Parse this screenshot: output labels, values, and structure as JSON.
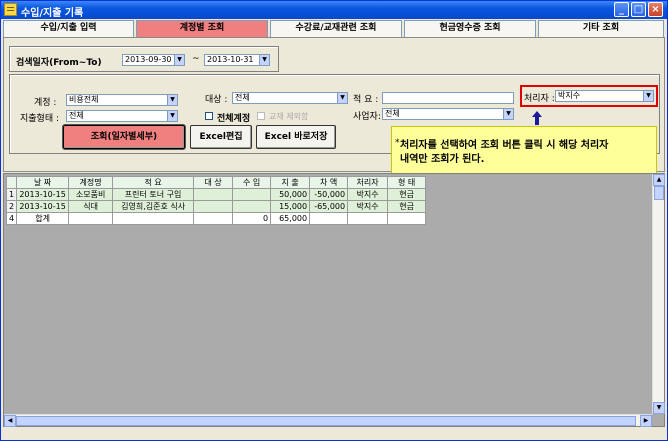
{
  "window": {
    "title": "수입/지출 기록"
  },
  "tabs": [
    {
      "label": "수입/지출 입력"
    },
    {
      "label": "계정별 조회"
    },
    {
      "label": "수강료/교재관련 조회"
    },
    {
      "label": "현금영수증 조회"
    },
    {
      "label": "기타 조회"
    }
  ],
  "date_search": {
    "label": "검색일자(From~To)",
    "from": "2013-09-30",
    "tilde": "~",
    "to": "2013-10-31"
  },
  "filters": {
    "account_label": "계정 :",
    "account_value": "비용전체",
    "expense_type_label": "지출형태 :",
    "expense_type_value": "전체",
    "target_label": "대상 :",
    "target_value": "전체",
    "all_accounts_label": "전체계정",
    "textbook_label": "교재 제외함",
    "summary_label": "적 요 :",
    "summary_value": "",
    "business_label": "사업자:",
    "business_value": "전체",
    "handler_label": "처리자 :",
    "handler_value": "박지수"
  },
  "buttons": {
    "search": "조회(일자별세부)",
    "excel_edit": "Excel편집",
    "excel_save": "Excel 바로저장"
  },
  "callout": {
    "star": "*",
    "line1": "처리자를 선택하여 조회 버튼 클릭 시 해당 처리자",
    "line2": "내역만 조회가 된다."
  },
  "table": {
    "headers": [
      "날 짜",
      "계정명",
      "적 요",
      "대 상",
      "수 입",
      "지 출",
      "차 액",
      "처리자",
      "형 태"
    ],
    "rows": [
      {
        "rn": "1",
        "date": "2013-10-15",
        "account": "소모품비",
        "summary": "프린터 토너 구입",
        "target": "",
        "income": "",
        "expense": "50,000",
        "balance": "-50,000",
        "handler": "박지수",
        "type": "현금"
      },
      {
        "rn": "2",
        "date": "2013-10-15",
        "account": "식대",
        "summary": "김영희,김준호 식사",
        "target": "",
        "income": "",
        "expense": "15,000",
        "balance": "-65,000",
        "handler": "박지수",
        "type": "현금"
      },
      {
        "rn": "4",
        "date": "합계",
        "account": "",
        "summary": "",
        "target": "",
        "income": "0",
        "expense": "65,000",
        "balance": "",
        "handler": "",
        "type": ""
      }
    ]
  },
  "colors": {
    "active_tab": "#f08080",
    "titlebar": "#0a56e0",
    "callout_bg": "#ffff99",
    "highlight_border": "#e00000"
  }
}
